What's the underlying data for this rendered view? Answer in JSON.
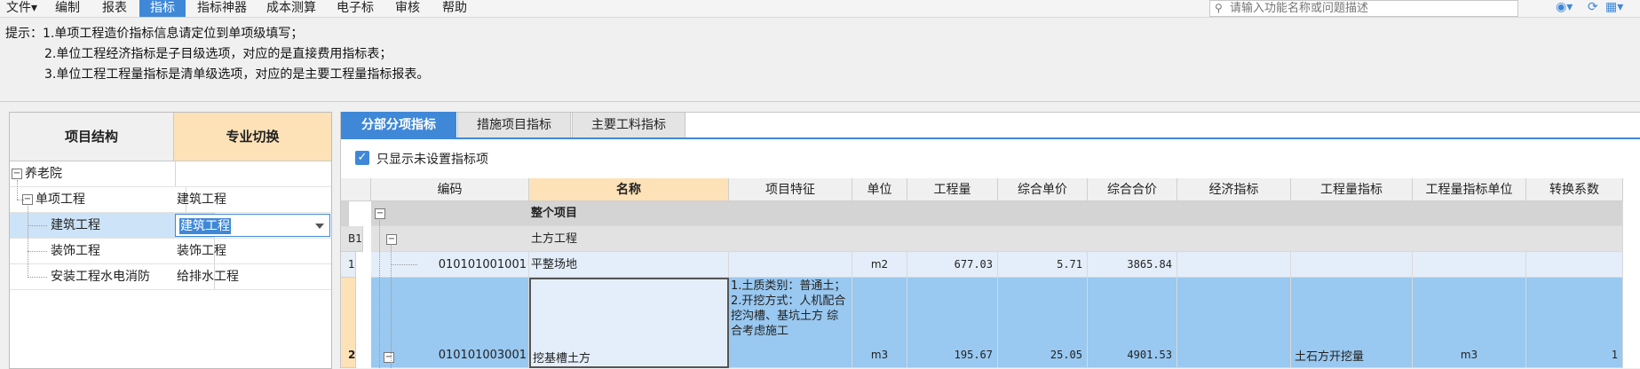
{
  "menu": {
    "items": [
      "文件▾",
      "编制",
      "报表",
      "指标",
      "指标神器",
      "成本测算",
      "电子标",
      "审核",
      "帮助"
    ],
    "active_index": 3
  },
  "search": {
    "placeholder": "请输入功能名称或问题描述"
  },
  "tips": {
    "line1": "提示：1.单项工程造价指标信息请定位到单项级填写；",
    "line2": "2.单位工程经济指标是子目级选项，对应的是直接费用指标表；",
    "line3": "3.单位工程工程量指标是清单级选项，对应的是主要工程量指标报表。"
  },
  "left_panel": {
    "col1": "项目结构",
    "col2": "专业切换",
    "rows": [
      {
        "name": "养老院",
        "spec": ""
      },
      {
        "name": "单项工程",
        "spec": "建筑工程"
      },
      {
        "name": "建筑工程",
        "spec": "建筑工程"
      },
      {
        "name": "装饰工程",
        "spec": "装饰工程"
      },
      {
        "name": "安装工程水电消防",
        "spec": "给排水工程"
      }
    ]
  },
  "tabs": [
    "分部分项指标",
    "措施项目指标",
    "主要工料指标"
  ],
  "checkbox": {
    "label": "只显示未设置指标项",
    "checked": true
  },
  "grid": {
    "columns": [
      "编码",
      "名称",
      "项目特征",
      "单位",
      "工程量",
      "综合单价",
      "综合合价",
      "经济指标",
      "工程量指标",
      "工程量指标单位",
      "转换系数"
    ],
    "rows": [
      {
        "rownum": "",
        "code": "",
        "name": "整个项目",
        "feature": "",
        "unit": "",
        "qty": "",
        "price": "",
        "total": "",
        "econ": "",
        "qty_idx": "",
        "qty_unit": "",
        "factor": ""
      },
      {
        "rownum": "B1",
        "code": "",
        "name": "土方工程",
        "feature": "",
        "unit": "",
        "qty": "",
        "price": "",
        "total": "",
        "econ": "",
        "qty_idx": "",
        "qty_unit": "",
        "factor": ""
      },
      {
        "rownum": "1",
        "code": "010101001001",
        "name": "平整场地",
        "feature": "",
        "unit": "m2",
        "qty": "677.03",
        "price": "5.71",
        "total": "3865.84",
        "econ": "",
        "qty_idx": "",
        "qty_unit": "",
        "factor": ""
      },
      {
        "rownum": "2",
        "code": "010101003001",
        "name": "挖基槽土方",
        "feature": "1.土质类别：普通土；\n2.开挖方式：人机配合挖沟槽、基坑土方 综合考虑施工",
        "unit": "m3",
        "qty": "195.67",
        "price": "25.05",
        "total": "4901.53",
        "econ": "",
        "qty_idx": "土石方开挖量",
        "qty_unit": "m3",
        "factor": "1"
      }
    ]
  },
  "colors": {
    "accent": "#3f88d8",
    "highlight": "#fde2b8",
    "selected_row": "#99c8f0"
  }
}
